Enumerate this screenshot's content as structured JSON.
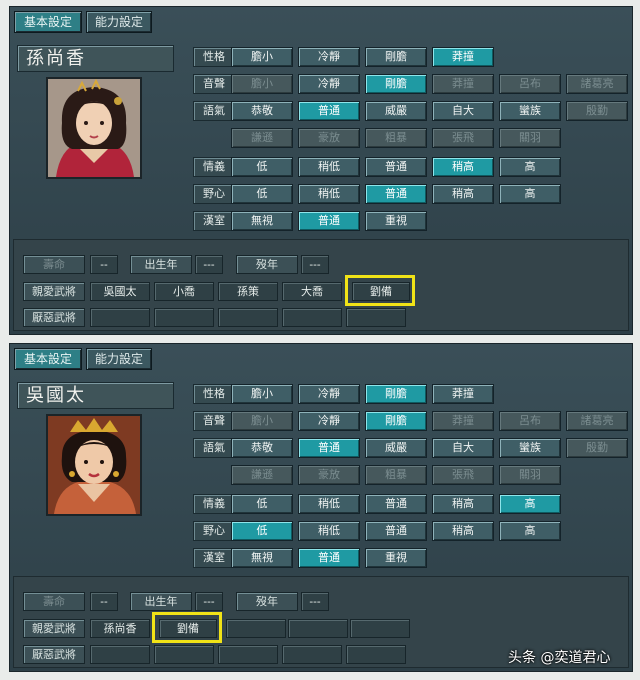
{
  "tabs": {
    "basic": "基本設定",
    "ability": "能力設定"
  },
  "row_labels": [
    "性格",
    "音聲",
    "語氣",
    "",
    "情義",
    "野心",
    "漢室"
  ],
  "bottom_labels": {
    "lifespan": "壽命",
    "birth_year": "出生年",
    "death_year": "歿年",
    "favorite": "親愛武將",
    "hated": "厭惡武將",
    "placeholder": "--",
    "placeholder3": "---"
  },
  "rows": {
    "personality": [
      "膽小",
      "冷靜",
      "剛膽",
      "莽撞"
    ],
    "voice": [
      "膽小",
      "冷靜",
      "剛膽",
      "莽撞",
      "呂布",
      "諸葛亮"
    ],
    "tone": [
      "恭敬",
      "普通",
      "威嚴",
      "自大",
      "蠻族",
      "殷勤"
    ],
    "tone2": [
      "謙遜",
      "豪放",
      "粗暴",
      "張飛",
      "關羽"
    ],
    "loyalty": [
      "低",
      "稍低",
      "普通",
      "稍高",
      "高"
    ],
    "ambition": [
      "低",
      "稍低",
      "普通",
      "稍高",
      "高"
    ],
    "han": [
      "無視",
      "普通",
      "重視"
    ]
  },
  "panels": [
    {
      "name": "孫尚香",
      "favorites": [
        "吳國太",
        "小喬",
        "孫策",
        "大喬",
        "劉備"
      ],
      "hated": [
        "",
        "",
        "",
        "",
        ""
      ],
      "selected": {
        "personality": 3,
        "voice": 2,
        "tone": 1,
        "loyalty": 3,
        "ambition": 2,
        "han": 1
      }
    },
    {
      "name": "吳國太",
      "favorites": [
        "孫尚香",
        "劉備",
        "",
        "",
        ""
      ],
      "hated": [
        "",
        "",
        "",
        "",
        ""
      ],
      "selected": {
        "personality": 2,
        "voice": 2,
        "tone": 1,
        "loyalty": 4,
        "ambition": 0,
        "han": 1
      }
    }
  ],
  "watermark": "头条 @奕道君心",
  "colors": {
    "selected": "#1f9aa3",
    "highlight": "#f1e317",
    "panel": "#32454d"
  }
}
